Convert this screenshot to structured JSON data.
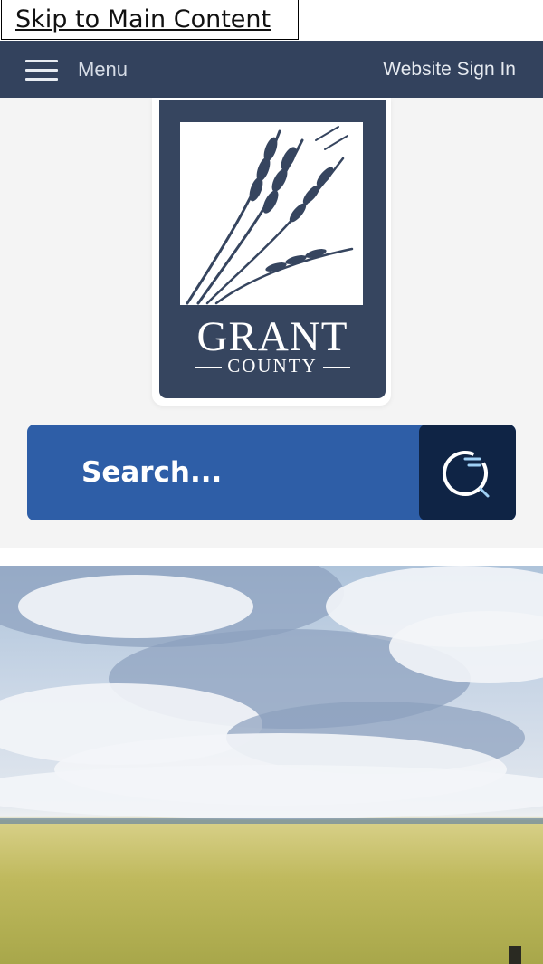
{
  "skip_link": "Skip to Main Content",
  "nav": {
    "menu_label": "Menu",
    "menu_icon": "hamburger-icon",
    "signin_label": "Website Sign In",
    "bg_color": "#33425d"
  },
  "logo": {
    "line1": "GRANT",
    "line2": "COUNTY",
    "icon": "wheat-icon",
    "bg_color": "#36455f"
  },
  "search": {
    "placeholder": "Search...",
    "button_icon": "search-icon",
    "bg_color": "#2e5ea7",
    "button_color": "#0f2445"
  },
  "hero": {
    "description_icon": "prairie-landscape-image"
  }
}
